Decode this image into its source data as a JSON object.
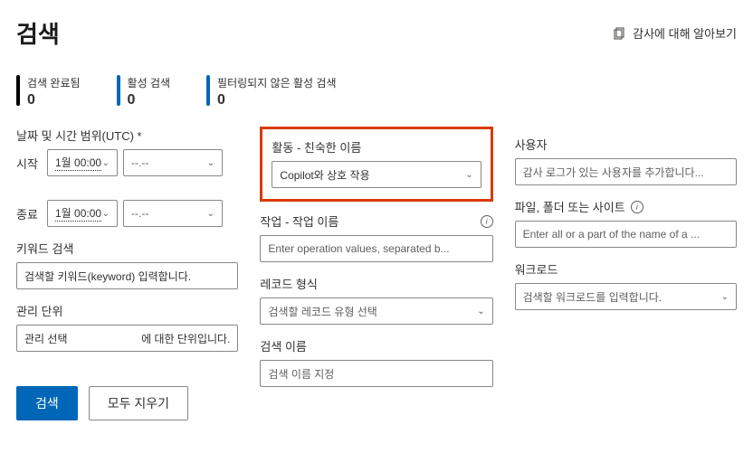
{
  "header": {
    "title": "검색",
    "learn_label": "감사에 대해 알아보기"
  },
  "counters": {
    "completed_label": "검색 완료됨",
    "completed_value": "0",
    "active_label": "활성 검색",
    "active_value": "0",
    "unfiltered_label": "필터링되지 않은 활성 검색",
    "unfiltered_value": "0"
  },
  "date": {
    "range_label": "날짜 및 시간 범위(UTC) *",
    "start_label": "시작",
    "start_date": "1월 00:00",
    "start_time": "--.--",
    "end_label": "종료",
    "end_date": "1월 00:00",
    "end_time": "--.--"
  },
  "keyword": {
    "label": "키워드 검색",
    "placeholder": "검색할 키워드(keyword) 입력합니다."
  },
  "admin": {
    "label": "관리 단위",
    "select_text": "관리 선택",
    "suffix": "에 대한 단위입니다."
  },
  "activities": {
    "label": "활동 - 친숙한 이름",
    "value": "Copilot와 상호 작용"
  },
  "operations": {
    "label": "작업 - 작업 이름",
    "placeholder": "Enter operation values, separated b..."
  },
  "record": {
    "label": "레코드 형식",
    "placeholder": "검색할 레코드 유형 선택"
  },
  "searchname": {
    "label": "검색 이름",
    "placeholder": "검색 이름 지정"
  },
  "users": {
    "label": "사용자",
    "placeholder": "감사 로그가 있는 사용자를 추가합니다..."
  },
  "files": {
    "label": "파일, 폴더 또는 사이트",
    "placeholder": "Enter all or a part of the name of a ..."
  },
  "workload": {
    "label": "워크로드",
    "placeholder": "검색할 워크로드를 입력합니다."
  },
  "buttons": {
    "search": "검색",
    "clear": "모두 지우기"
  }
}
